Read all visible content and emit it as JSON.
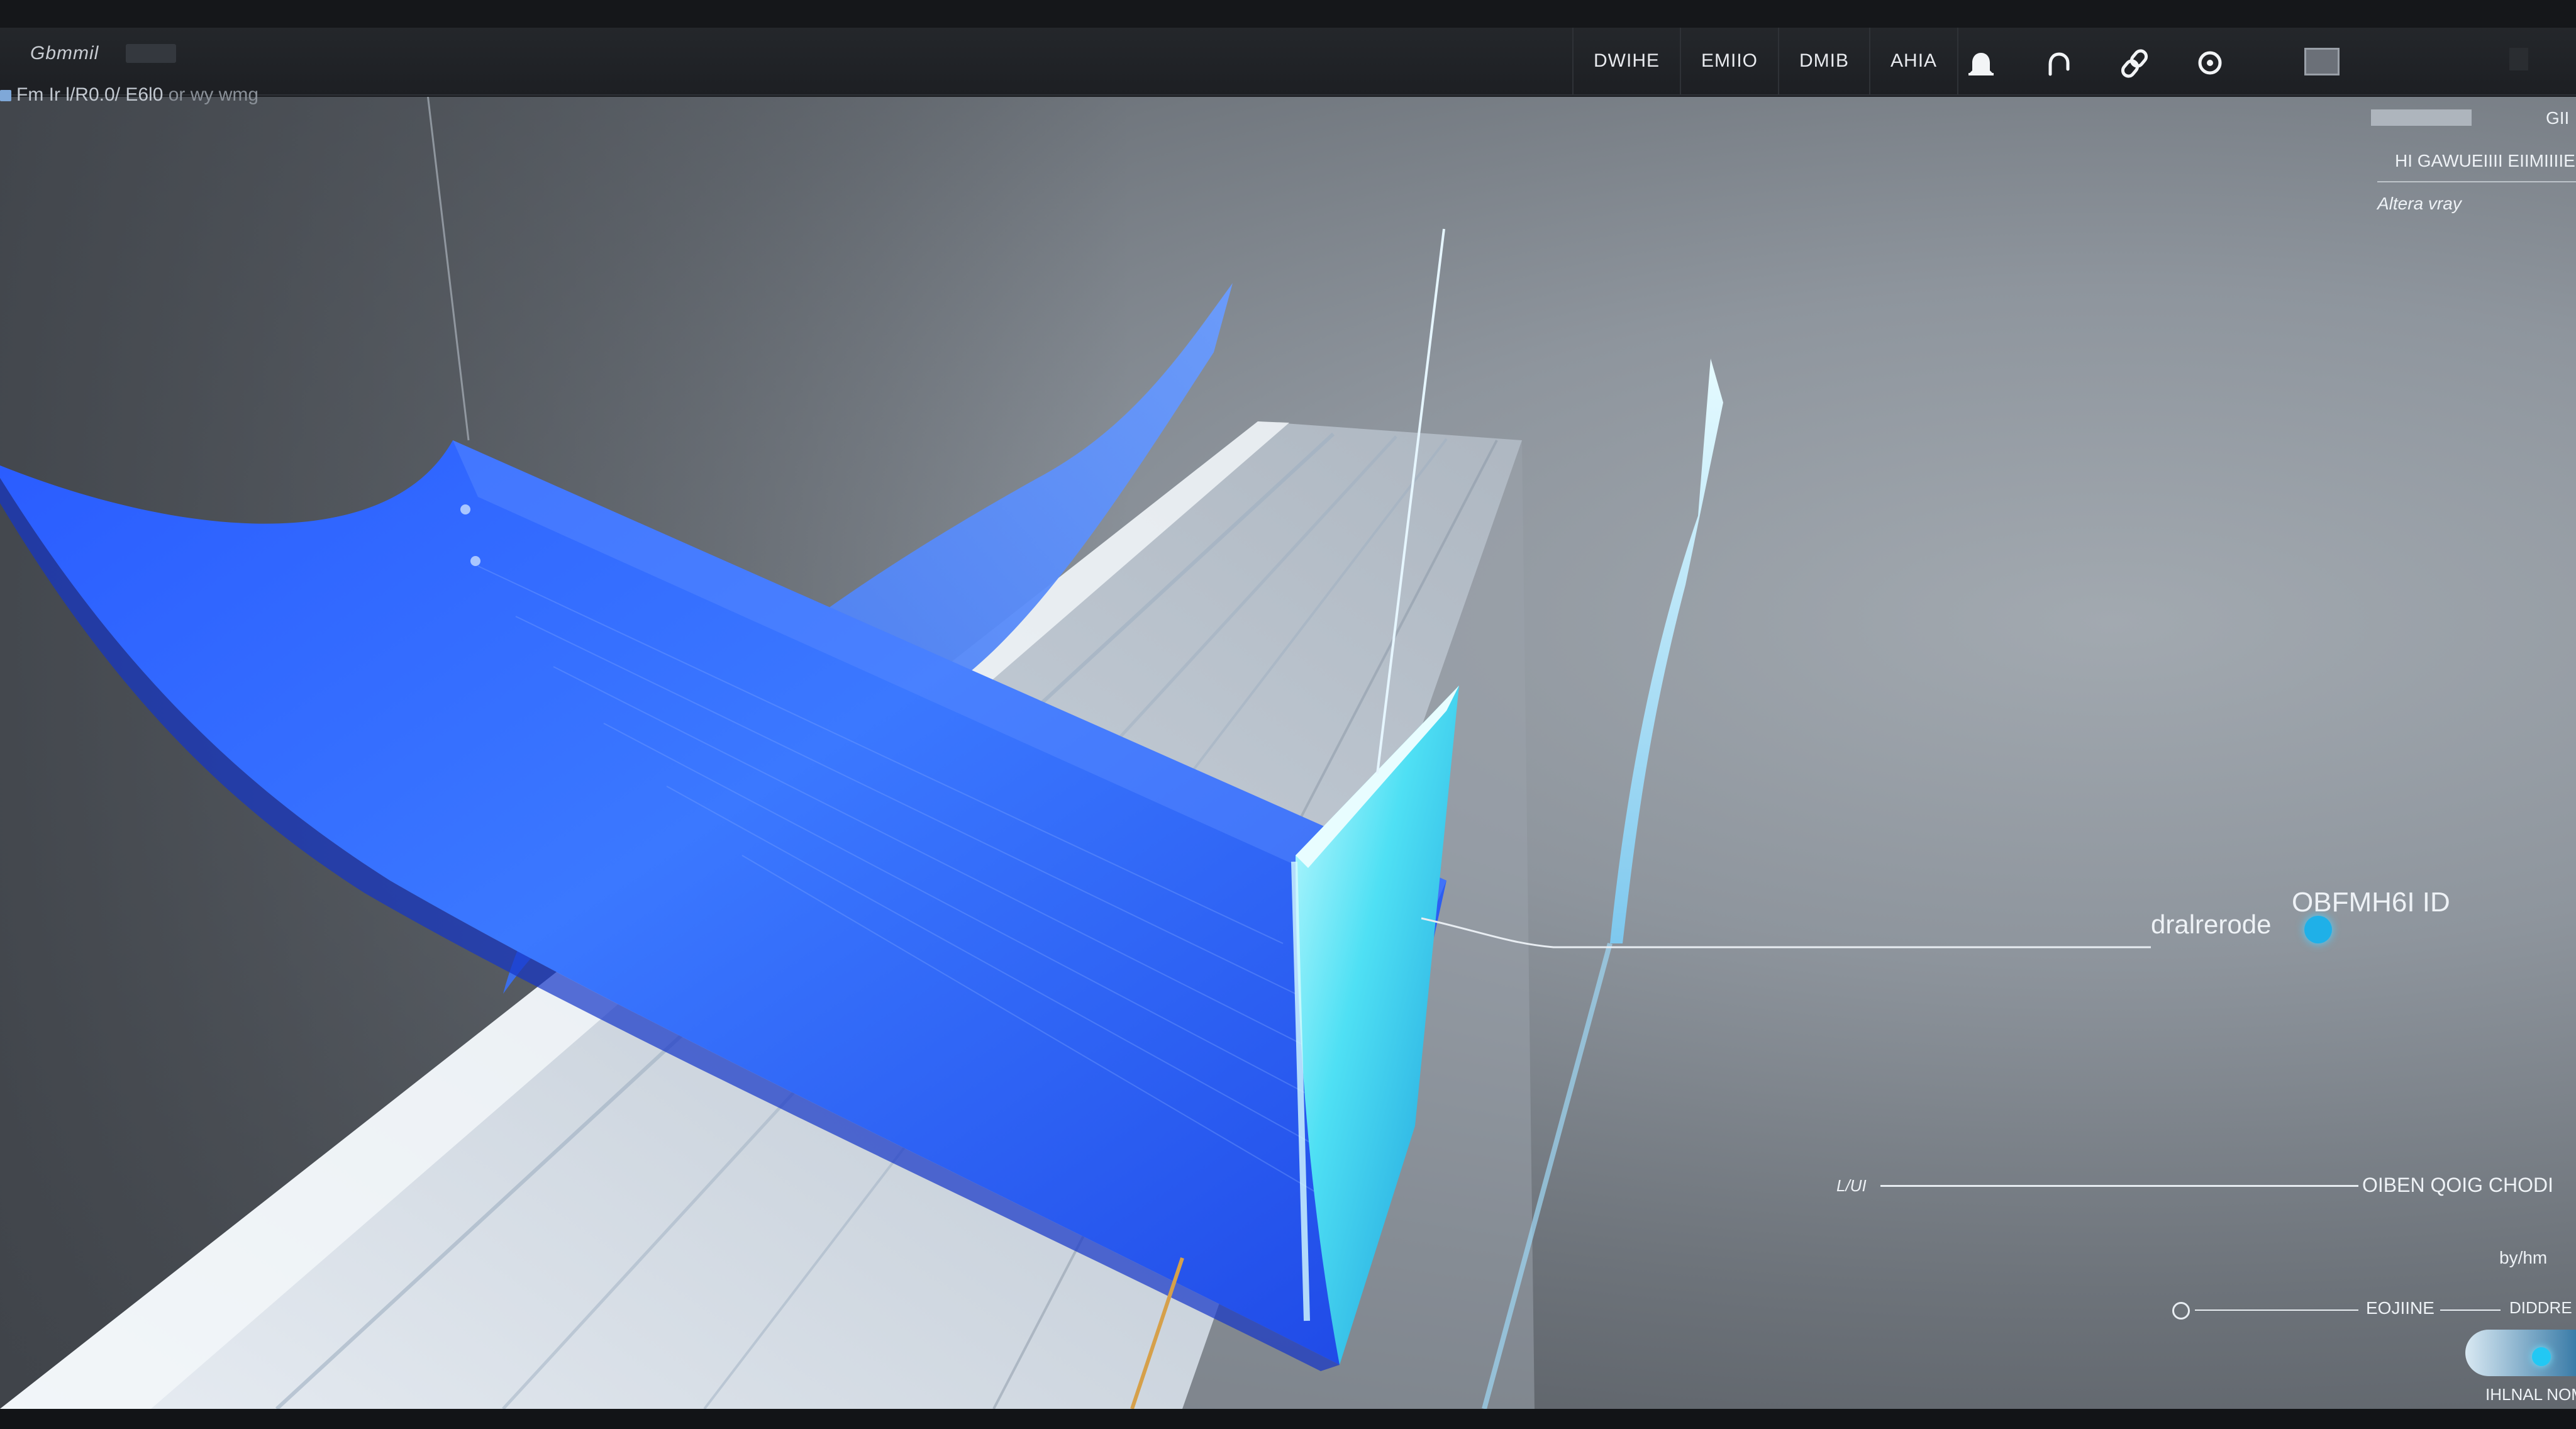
{
  "window": {
    "title": "Gbmmil",
    "status_line": "Fm Ir l/R0.0/ E6l0",
    "status_suffix": "or wy wmg"
  },
  "menu": {
    "items": [
      "DWIHE",
      "EMIIO",
      "DMIB",
      "AHIA"
    ]
  },
  "toolbar_icons": [
    "bell-icon",
    "refresh-icon",
    "link-icon",
    "record-icon"
  ],
  "panel": {
    "header_value": "GII",
    "subtitle": "HI GAWUEIIII EIIMIIIIE",
    "note": "Altera vray",
    "readout_label": "dralrerode",
    "readout_value": "OBFMH6I ID",
    "axis_left_label": "L/UI",
    "axis_right_label": "OIBEN QOIG CHODI",
    "mid_label": "by/hm",
    "control_label": "EOJIINE",
    "control_suffix": "DIDDRE",
    "footer_label": "IHLNAL NOM"
  },
  "colors": {
    "accent_blue": "#2f6bff",
    "accent_cyan": "#2ad6f0",
    "readout_dot": "#1fb0e8"
  }
}
